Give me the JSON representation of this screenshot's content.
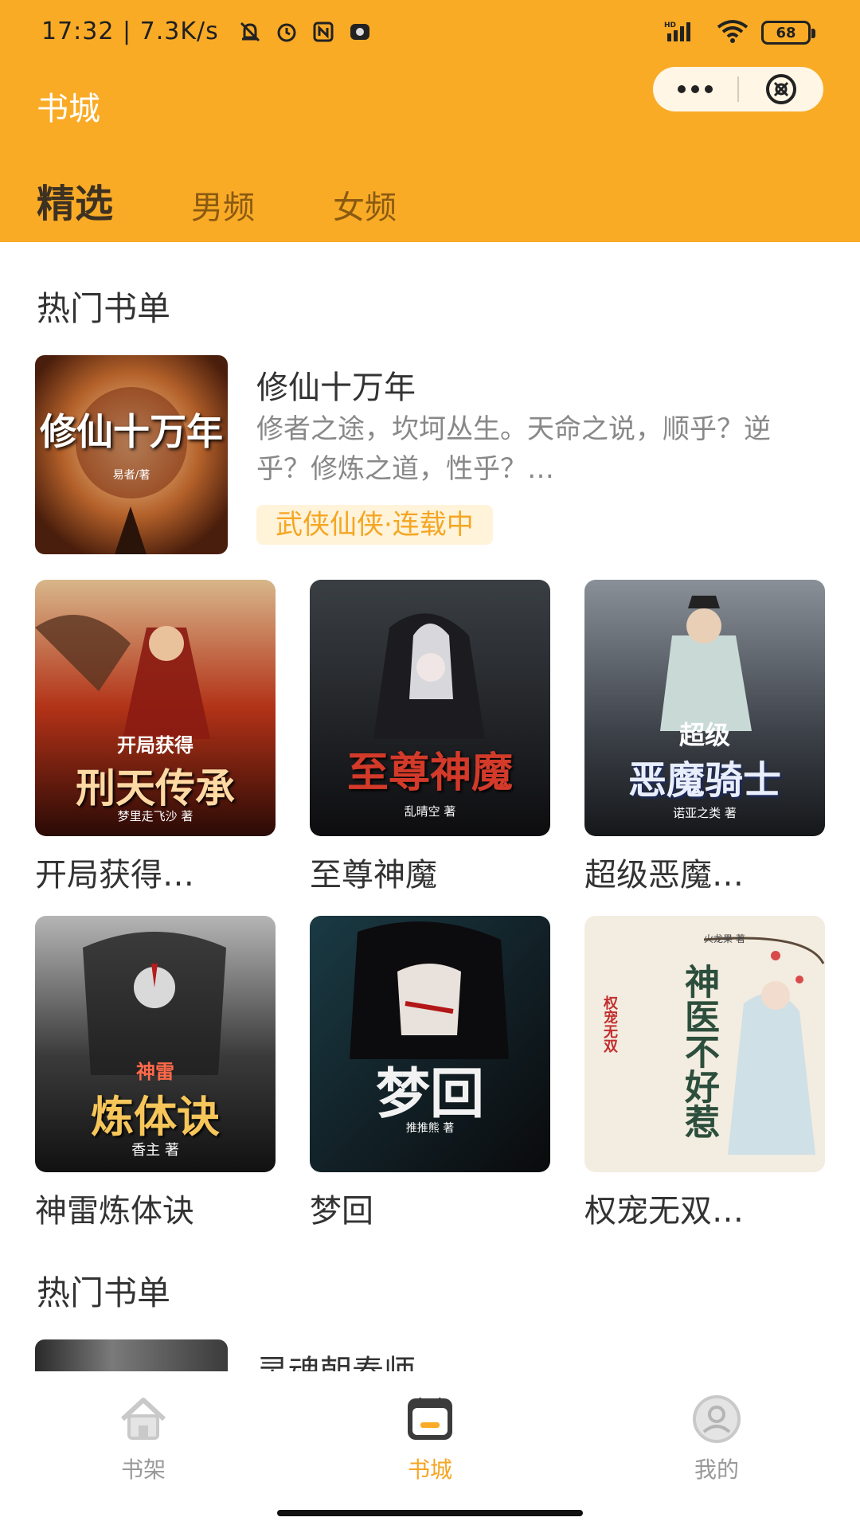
{
  "status_bar": {
    "time": "17:32",
    "speed": "7.3K/s",
    "battery": "68"
  },
  "header": {
    "title": "书城",
    "capsule_more": "•••",
    "capsule_close": "close"
  },
  "tabs": [
    {
      "label": "精选",
      "active": true
    },
    {
      "label": "男频",
      "active": false
    },
    {
      "label": "女频",
      "active": false
    }
  ],
  "sections": [
    {
      "title": "热门书单"
    },
    {
      "title": "热门书单"
    }
  ],
  "featured": {
    "title": "修仙十万年",
    "description": "修者之途，坎坷丛生。天命之说，顺乎？逆乎？修炼之道，性乎？…",
    "tag": "武侠仙侠·连载中",
    "cover_text": "修仙十万年",
    "cover_author": "易者/著"
  },
  "books_row1": [
    {
      "title": "开局获得…",
      "cover_text": "刑天传承",
      "cover_sub": "开局获得",
      "cover_author": "梦里走飞沙 著"
    },
    {
      "title": "至尊神魔",
      "cover_text": "至尊神魔",
      "cover_sub": "",
      "cover_author": "乱晴空 著"
    },
    {
      "title": "超级恶魔…",
      "cover_text": "恶魔骑士",
      "cover_sub": "超级",
      "cover_author": "诺亚之类 著"
    }
  ],
  "books_row2": [
    {
      "title": "神雷炼体诀",
      "cover_text": "炼体诀",
      "cover_sub": "神雷",
      "cover_author": "香主 著"
    },
    {
      "title": "梦回",
      "cover_text": "梦回",
      "cover_sub": "",
      "cover_author": "推推熊 著"
    },
    {
      "title": "权宠无双…",
      "cover_text": "神医不好惹",
      "cover_sub": "权宠无双",
      "cover_author": "火龙果 著"
    }
  ],
  "next_item": {
    "title": "灵魂朝奏师"
  },
  "bottom_nav": [
    {
      "label": "书架",
      "icon": "home-icon",
      "active": false
    },
    {
      "label": "书城",
      "icon": "store-icon",
      "active": true
    },
    {
      "label": "我的",
      "icon": "profile-icon",
      "active": false
    }
  ],
  "colors": {
    "accent": "#F9AB26",
    "tag_text": "#F5A623",
    "tag_bg": "#FFF3DA"
  }
}
